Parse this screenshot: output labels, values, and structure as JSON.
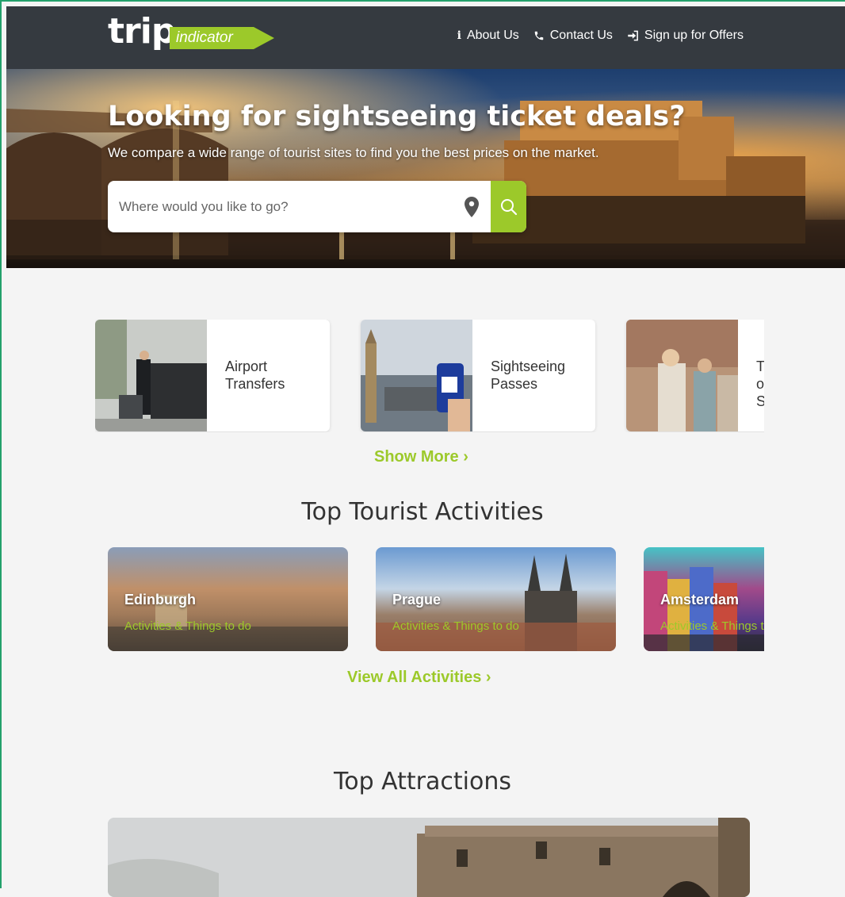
{
  "brand": {
    "logo_main": "trip",
    "logo_tag": "indicator",
    "accent": "#9cc92a",
    "header_bg": "#353a40"
  },
  "nav": [
    {
      "label": "About Us",
      "icon": "info-icon"
    },
    {
      "label": "Contact Us",
      "icon": "phone-icon"
    },
    {
      "label": "Sign up for Offers",
      "icon": "sign-in-icon"
    }
  ],
  "hero": {
    "title": "Looking for sightseeing ticket deals?",
    "subtitle": "We compare a wide range of tourist sites to find you the best prices on the market.",
    "search_placeholder": "Where would you like to go?"
  },
  "categories": [
    {
      "label": "Airport Transfers"
    },
    {
      "label": "Sightseeing Passes"
    },
    {
      "label": "To S"
    }
  ],
  "show_more": "Show More ›",
  "activities_title": "Top Tourist Activities",
  "activities": [
    {
      "city": "Edinburgh",
      "sub": "Activities & Things to do"
    },
    {
      "city": "Prague",
      "sub": "Activities & Things to do"
    },
    {
      "city": "Amsterdam",
      "sub": "Activities & Things to do"
    }
  ],
  "view_all": "View All Activities ›",
  "attractions_title": "Top Attractions"
}
